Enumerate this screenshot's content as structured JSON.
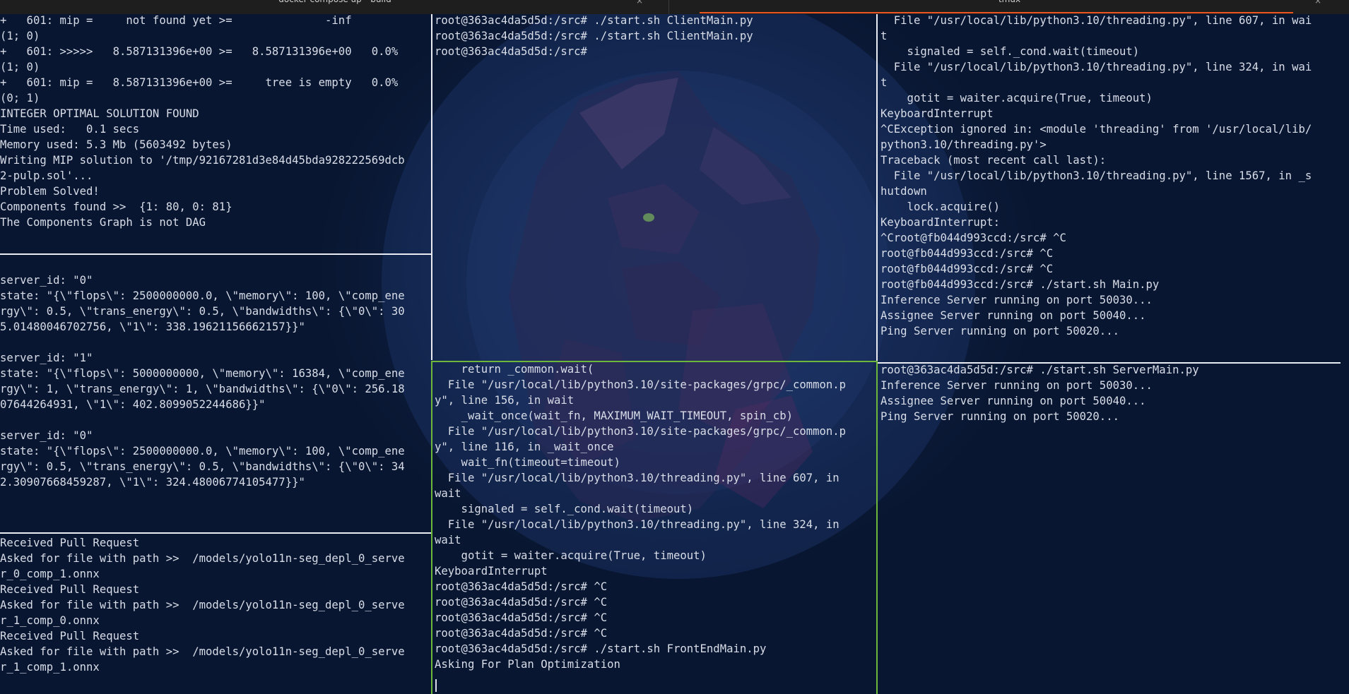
{
  "tabs": [
    {
      "label": "docker compose up --build"
    },
    {
      "label": "tmux"
    }
  ],
  "colors": {
    "background": "#0a1a36",
    "text": "#d8dde8",
    "active_border": "#6db83b",
    "divider": "#e9ecf2",
    "tab_accent": "#e95420"
  },
  "panes": {
    "left_top": {
      "lines": [
        "+   601: mip =     not found yet >=              -inf",
        "(1; 0)",
        "+   601: >>>>>   8.587131396e+00 >=   8.587131396e+00   0.0%",
        "(1; 0)",
        "+   601: mip =   8.587131396e+00 >=     tree is empty   0.0%",
        "(0; 1)",
        "INTEGER OPTIMAL SOLUTION FOUND",
        "Time used:   0.1 secs",
        "Memory used: 5.3 Mb (5603492 bytes)",
        "Writing MIP solution to '/tmp/92167281d3e84d45bda928222569dcb",
        "2-pulp.sol'...",
        "Problem Solved!",
        "Components found >>  {1: 80, 0: 81}",
        "The Components Graph is not DAG"
      ]
    },
    "left_middle": {
      "lines": [
        "",
        "server_id: \"0\"",
        "state: \"{\\\"flops\\\": 2500000000.0, \\\"memory\\\": 100, \\\"comp_ene",
        "rgy\\\": 0.5, \\\"trans_energy\\\": 0.5, \\\"bandwidths\\\": {\\\"0\\\": 30",
        "5.01480046702756, \\\"1\\\": 338.19621156662157}}\"",
        "",
        "server_id: \"1\"",
        "state: \"{\\\"flops\\\": 5000000000, \\\"memory\\\": 16384, \\\"comp_ene",
        "rgy\\\": 1, \\\"trans_energy\\\": 1, \\\"bandwidths\\\": {\\\"0\\\": 256.18",
        "07644264931, \\\"1\\\": 402.8099052244686}}\"",
        "",
        "server_id: \"0\"",
        "state: \"{\\\"flops\\\": 2500000000.0, \\\"memory\\\": 100, \\\"comp_ene",
        "rgy\\\": 0.5, \\\"trans_energy\\\": 0.5, \\\"bandwidths\\\": {\\\"0\\\": 34",
        "2.30907668459287, \\\"1\\\": 324.48006774105477}}\""
      ]
    },
    "left_bottom": {
      "lines": [
        "Received Pull Request",
        "Asked for file with path >>  /models/yolo11n-seg_depl_0_serve",
        "r_0_comp_1.onnx",
        "Received Pull Request",
        "Asked for file with path >>  /models/yolo11n-seg_depl_0_serve",
        "r_1_comp_0.onnx",
        "Received Pull Request",
        "Asked for file with path >>  /models/yolo11n-seg_depl_0_serve",
        "r_1_comp_1.onnx"
      ]
    },
    "middle_top": {
      "lines": [
        "root@363ac4da5d5d:/src# ./start.sh ClientMain.py",
        "root@363ac4da5d5d:/src# ./start.sh ClientMain.py",
        "root@363ac4da5d5d:/src#"
      ]
    },
    "middle_bottom": {
      "lines": [
        "    return _common.wait(",
        "  File \"/usr/local/lib/python3.10/site-packages/grpc/_common.p",
        "y\", line 156, in wait",
        "    _wait_once(wait_fn, MAXIMUM_WAIT_TIMEOUT, spin_cb)",
        "  File \"/usr/local/lib/python3.10/site-packages/grpc/_common.p",
        "y\", line 116, in _wait_once",
        "    wait_fn(timeout=timeout)",
        "  File \"/usr/local/lib/python3.10/threading.py\", line 607, in",
        "wait",
        "    signaled = self._cond.wait(timeout)",
        "  File \"/usr/local/lib/python3.10/threading.py\", line 324, in",
        "wait",
        "    gotit = waiter.acquire(True, timeout)",
        "KeyboardInterrupt",
        "root@363ac4da5d5d:/src# ^C",
        "root@363ac4da5d5d:/src# ^C",
        "root@363ac4da5d5d:/src# ^C",
        "root@363ac4da5d5d:/src# ^C",
        "root@363ac4da5d5d:/src# ./start.sh FrontEndMain.py",
        "Asking For Plan Optimization"
      ]
    },
    "right_top": {
      "lines": [
        "  File \"/usr/local/lib/python3.10/threading.py\", line 607, in wai",
        "t",
        "    signaled = self._cond.wait(timeout)",
        "  File \"/usr/local/lib/python3.10/threading.py\", line 324, in wai",
        "t",
        "    gotit = waiter.acquire(True, timeout)",
        "KeyboardInterrupt",
        "^CException ignored in: <module 'threading' from '/usr/local/lib/",
        "python3.10/threading.py'>",
        "Traceback (most recent call last):",
        "  File \"/usr/local/lib/python3.10/threading.py\", line 1567, in _s",
        "hutdown",
        "    lock.acquire()",
        "KeyboardInterrupt:",
        "^Croot@fb044d993ccd:/src# ^C",
        "root@fb044d993ccd:/src# ^C",
        "root@fb044d993ccd:/src# ^C",
        "root@fb044d993ccd:/src# ./start.sh Main.py",
        "Inference Server running on port 50030...",
        "Assignee Server running on port 50040...",
        "Ping Server running on port 50020..."
      ]
    },
    "right_bottom": {
      "lines": [
        "root@363ac4da5d5d:/src# ./start.sh ServerMain.py",
        "Inference Server running on port 50030...",
        "Assignee Server running on port 50040...",
        "Ping Server running on port 50020..."
      ]
    }
  }
}
